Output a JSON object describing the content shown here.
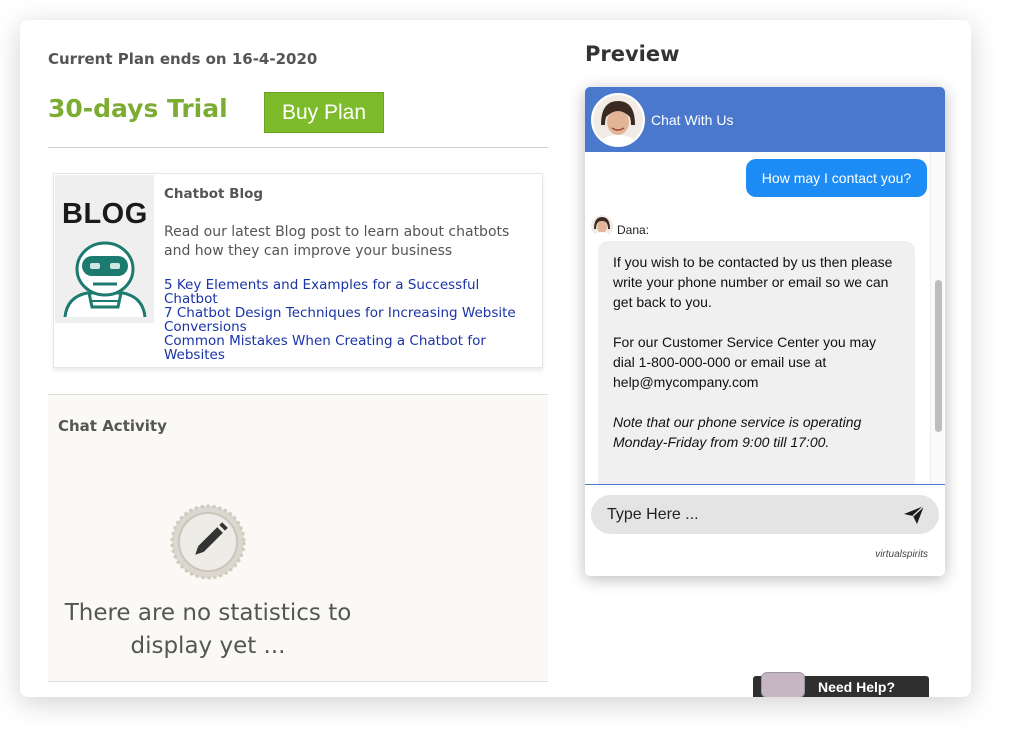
{
  "plan": {
    "ends_text": "Current Plan ends on 16-4-2020",
    "trial_label": "30-days Trial",
    "buy_button": "Buy Plan"
  },
  "blog": {
    "image_text": "BLOG",
    "title": "Chatbot Blog",
    "description": "Read our latest Blog post to learn about chatbots and how they can improve your business",
    "links": [
      "5 Key Elements and Examples for a Successful Chatbot",
      "7 Chatbot Design Techniques for Increasing Website Conversions",
      "Common Mistakes When Creating a Chatbot for Websites"
    ]
  },
  "activity": {
    "title": "Chat Activity",
    "empty_message": "There are no statistics to display yet ..."
  },
  "preview": {
    "title": "Preview",
    "header_title": "Chat With Us",
    "user_message": "How may I contact you?",
    "agent_name": "Dana:",
    "agent_paragraphs": [
      "If you wish to be contacted by us then please write your phone number or email so we can get back to you.",
      "For our Customer Service Center you may dial 1-800-000-000 or email use at help@mycompany.com",
      "Note that our phone service is operating Monday-Friday from 9:00 till 17:00."
    ],
    "input_placeholder": "Type Here ...",
    "powered_by": "virtualspirits"
  },
  "help_tab": {
    "label": "Need Help?"
  },
  "colors": {
    "trial_green": "#7cad32",
    "buy_button_green": "#7dbb2a",
    "chat_header_blue": "#4a78cd",
    "user_bubble_blue": "#1e8cf5",
    "link_blue": "#1a33a6"
  },
  "icons": {
    "send": "paper-plane-icon",
    "empty_stats": "pencil-icon",
    "blog_image": "robot-icon"
  }
}
